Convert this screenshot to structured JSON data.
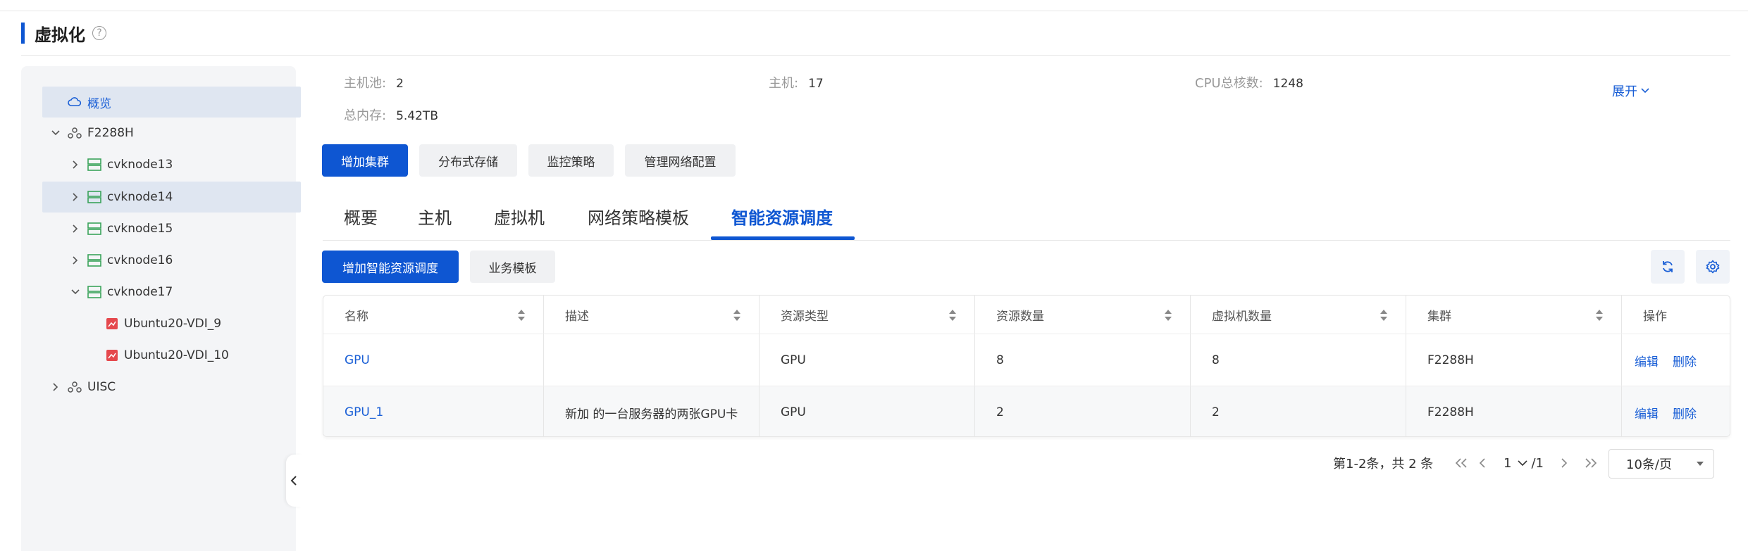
{
  "page": {
    "title": "虚拟化",
    "help_icon": "question-circle-icon"
  },
  "sidebar": {
    "items": [
      {
        "label": "概览",
        "icon": "cloud-icon",
        "selected": true
      },
      {
        "label": "F2288H",
        "icon": "cluster-icon",
        "expanded": true
      },
      {
        "label": "cvknode13",
        "icon": "server-icon"
      },
      {
        "label": "cvknode14",
        "icon": "server-icon",
        "selected": true
      },
      {
        "label": "cvknode15",
        "icon": "server-icon"
      },
      {
        "label": "cvknode16",
        "icon": "server-icon"
      },
      {
        "label": "cvknode17",
        "icon": "server-icon",
        "expanded": true
      },
      {
        "label": "Ubuntu20-VDI_9",
        "icon": "vm-icon"
      },
      {
        "label": "Ubuntu20-VDI_10",
        "icon": "vm-icon"
      },
      {
        "label": "UISC",
        "icon": "cluster-icon"
      }
    ]
  },
  "summary": {
    "host_pool_label": "主机池:",
    "host_pool_value": "2",
    "host_label": "主机:",
    "host_value": "17",
    "cpu_label": "CPU总核数:",
    "cpu_value": "1248",
    "memory_label": "总内存:",
    "memory_value": "5.42TB",
    "expand_label": "展开"
  },
  "actions": {
    "add_cluster": "增加集群",
    "distributed_storage": "分布式存储",
    "monitor_policy": "监控策略",
    "manage_network": "管理网络配置"
  },
  "tabs": [
    "概要",
    "主机",
    "虚拟机",
    "网络策略模板",
    "智能资源调度"
  ],
  "active_tab": "智能资源调度",
  "toolbar": {
    "add_drs": "增加智能资源调度",
    "business_template": "业务模板"
  },
  "table": {
    "columns": [
      "名称",
      "描述",
      "资源类型",
      "资源数量",
      "虚拟机数量",
      "集群",
      "操作"
    ],
    "rows": [
      {
        "name": "GPU",
        "desc": "",
        "type": "GPU",
        "count": "8",
        "vm_count": "8",
        "cluster": "F2288H",
        "edit": "编辑",
        "delete": "删除"
      },
      {
        "name": "GPU_1",
        "desc": "新加 的一台服务器的两张GPU卡",
        "type": "GPU",
        "count": "2",
        "vm_count": "2",
        "cluster": "F2288H",
        "edit": "编辑",
        "delete": "删除"
      }
    ]
  },
  "pagination": {
    "range_text": "第1-2条，共 2 条",
    "current_page": "1",
    "total_pages": "/1",
    "page_size": "10条/页"
  },
  "colors": {
    "primary": "#0e56d2",
    "link": "#1a5fd6"
  }
}
